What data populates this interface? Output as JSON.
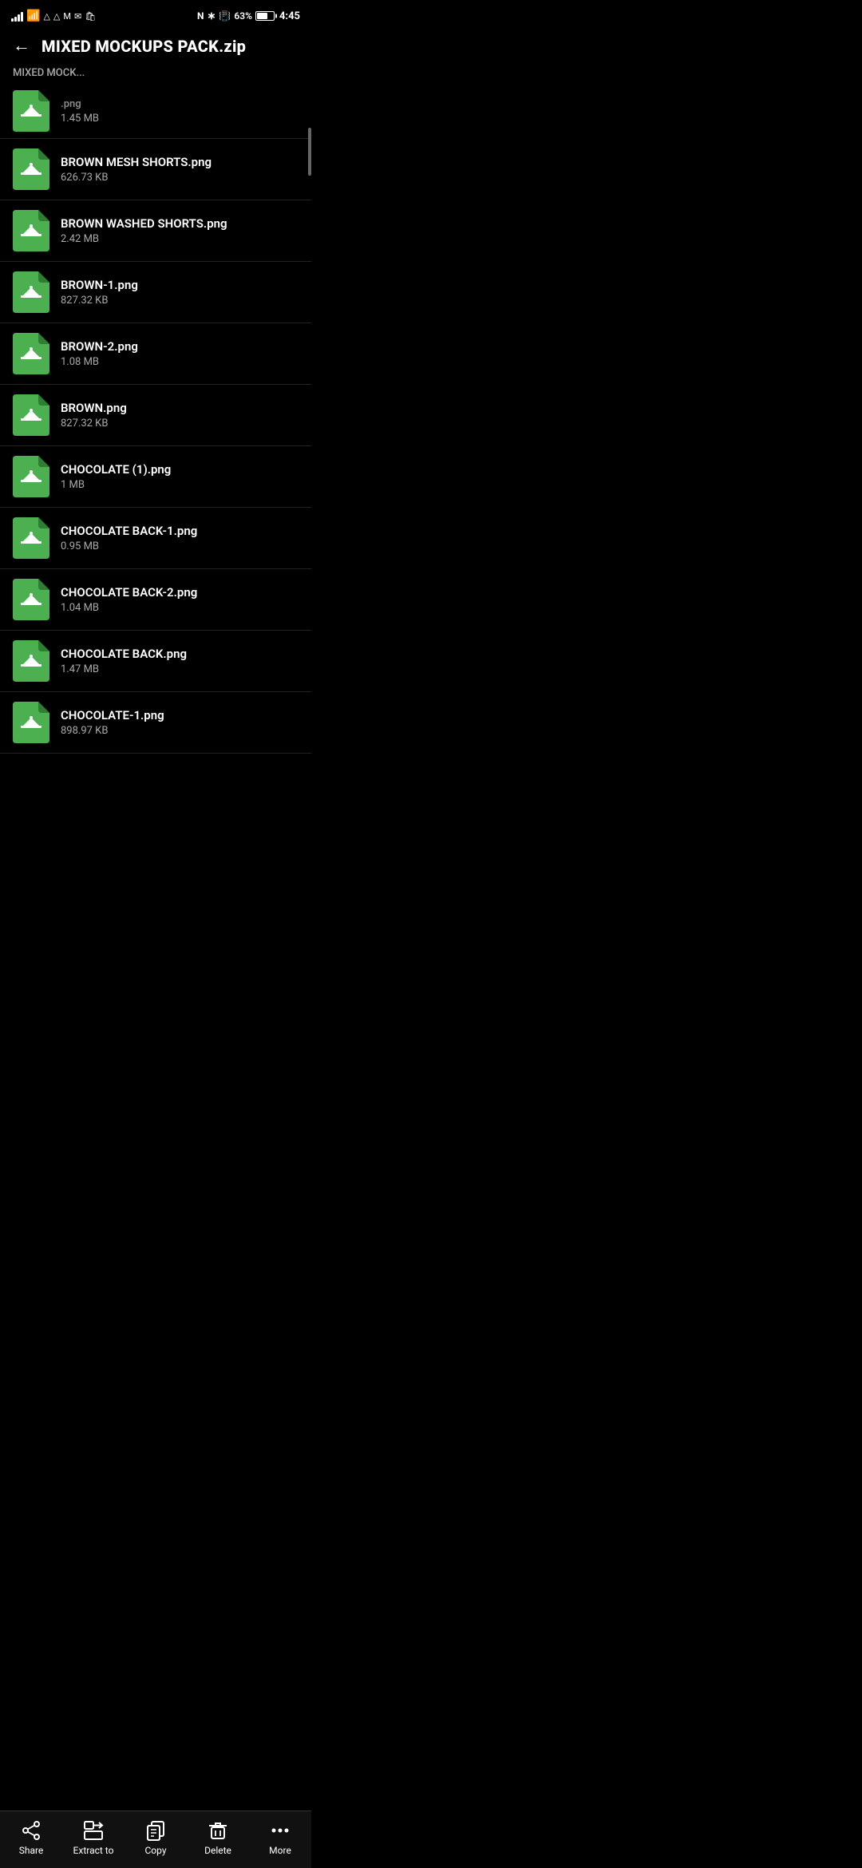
{
  "status_bar": {
    "time": "4:45",
    "battery_percent": "63%",
    "signal": "signal",
    "wifi": "wifi",
    "bluetooth": "bluetooth",
    "nfc": "N",
    "vibrate": "vibrate",
    "notification_icons": [
      "△",
      "△",
      "M",
      "✉",
      "🛍"
    ]
  },
  "header": {
    "title": "MIXED MOCKUPS PACK.zip",
    "back_label": "←"
  },
  "breadcrumb": {
    "text": "MIXED MOCK..."
  },
  "files": [
    {
      "name": "(partial)",
      "size": "1.45 MB",
      "visible": "partial"
    },
    {
      "name": "BROWN MESH SHORTS.png",
      "size": "626.73 KB"
    },
    {
      "name": "BROWN WASHED SHORTS.png",
      "size": "2.42 MB"
    },
    {
      "name": "BROWN-1.png",
      "size": "827.32 KB"
    },
    {
      "name": "BROWN-2.png",
      "size": "1.08 MB"
    },
    {
      "name": "BROWN.png",
      "size": "827.32 KB"
    },
    {
      "name": "CHOCOLATE (1).png",
      "size": "1 MB"
    },
    {
      "name": "CHOCOLATE BACK-1.png",
      "size": "0.95 MB"
    },
    {
      "name": "CHOCOLATE BACK-2.png",
      "size": "1.04 MB"
    },
    {
      "name": "CHOCOLATE BACK.png",
      "size": "1.47 MB"
    },
    {
      "name": "CHOCOLATE-1.png",
      "size": "898.97 KB"
    }
  ],
  "toolbar": {
    "items": [
      {
        "id": "share",
        "label": "Share",
        "icon": "share"
      },
      {
        "id": "extract",
        "label": "Extract to",
        "icon": "extract"
      },
      {
        "id": "copy",
        "label": "Copy",
        "icon": "copy"
      },
      {
        "id": "delete",
        "label": "Delete",
        "icon": "delete"
      },
      {
        "id": "more",
        "label": "More",
        "icon": "more"
      }
    ]
  }
}
